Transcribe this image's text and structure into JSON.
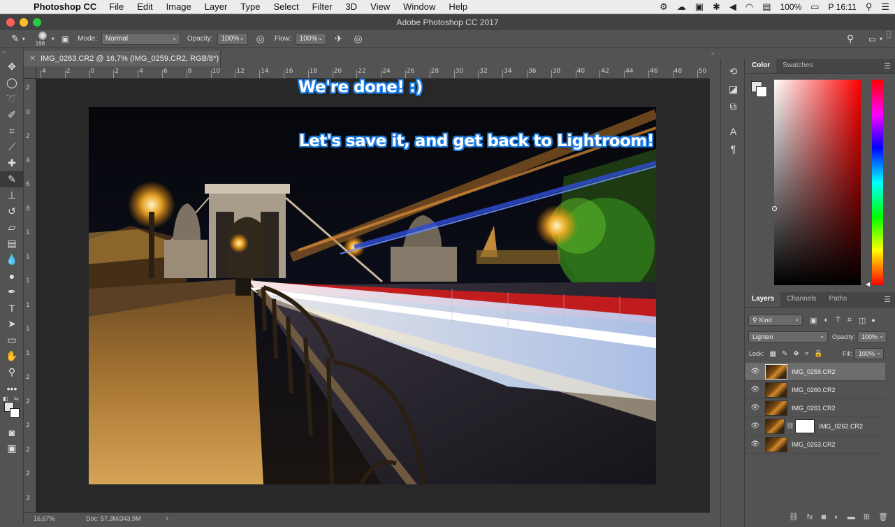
{
  "menubar": {
    "app_name": "Photoshop CC",
    "items": [
      "File",
      "Edit",
      "Image",
      "Layer",
      "Type",
      "Select",
      "Filter",
      "3D",
      "View",
      "Window",
      "Help"
    ],
    "battery": "100%",
    "clock": "P 16:11"
  },
  "window": {
    "title": "Adobe Photoshop CC 2017"
  },
  "options": {
    "brush_size": "198",
    "mode_label": "Mode:",
    "mode_value": "Normal",
    "opacity_label": "Opacity:",
    "opacity_value": "100%",
    "flow_label": "Flow:",
    "flow_value": "100%"
  },
  "document": {
    "tab_title": "IMG_0263.CR2 @ 16,7% (IMG_0259.CR2, RGB/8*) *",
    "ruler_top": [
      "4",
      "2",
      "0",
      "2",
      "4",
      "6",
      "8",
      "10",
      "12",
      "14",
      "16",
      "18",
      "20",
      "22",
      "24",
      "26",
      "28",
      "30",
      "32",
      "34",
      "36",
      "38",
      "40",
      "42",
      "44",
      "46",
      "48",
      "50"
    ],
    "ruler_left": [
      "2",
      "0",
      "2",
      "4",
      "6",
      "8",
      "1",
      "1",
      "1",
      "1",
      "1",
      "1",
      "2",
      "2",
      "2",
      "2",
      "2",
      "3"
    ]
  },
  "overlay": {
    "line1": "We're done! :)",
    "line2": "Let's save it, and get back to Lightroom!"
  },
  "status": {
    "zoom": "16,67%",
    "doc": "Doc: 57,3M/343,9M"
  },
  "color_panel": {
    "tabs": [
      "Color",
      "Swatches"
    ]
  },
  "layers_panel": {
    "tabs": [
      "Layers",
      "Channels",
      "Paths"
    ],
    "kind_label": "Kind",
    "blend_mode": "Lighten",
    "opacity_label": "Opacity:",
    "opacity_value": "100%",
    "lock_label": "Lock:",
    "fill_label": "Fill:",
    "fill_value": "100%",
    "layers": [
      {
        "name": "IMG_0259.CR2",
        "selected": true,
        "mask": false
      },
      {
        "name": "IMG_0260.CR2",
        "selected": false,
        "mask": false
      },
      {
        "name": "IMG_0261.CR2",
        "selected": false,
        "mask": false
      },
      {
        "name": "IMG_0262.CR2",
        "selected": false,
        "mask": true
      },
      {
        "name": "IMG_0263.CR2",
        "selected": false,
        "mask": false
      }
    ]
  },
  "colors": {
    "overlay_outline": "#1d7be0",
    "selected_layer": "#6d6d6d"
  }
}
